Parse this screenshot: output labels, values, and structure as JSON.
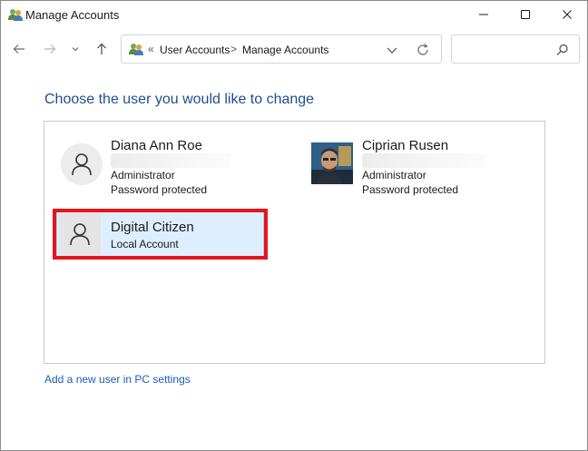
{
  "window": {
    "title": "Manage Accounts"
  },
  "address": {
    "overflow": "«",
    "crumbs": [
      "User Accounts",
      "Manage Accounts"
    ],
    "separator": ">"
  },
  "search": {
    "placeholder": ""
  },
  "main": {
    "heading": "Choose the user you would like to change",
    "accounts": [
      {
        "name": "Diana Ann Roe",
        "lines": [
          "Administrator",
          "Password protected"
        ],
        "avatar": "default-user-icon"
      },
      {
        "name": "Ciprian Rusen",
        "lines": [
          "Administrator",
          "Password protected"
        ],
        "avatar": "photo"
      },
      {
        "name": "Digital Citizen",
        "lines": [
          "Local Account"
        ],
        "avatar": "default-user-icon",
        "selected": true
      }
    ],
    "add_user_link": "Add a new user in PC settings"
  },
  "colors": {
    "heading": "#1e4e8c",
    "link": "#1a5fb4",
    "selection": "#ddeeff",
    "highlight": "#e8141b"
  }
}
